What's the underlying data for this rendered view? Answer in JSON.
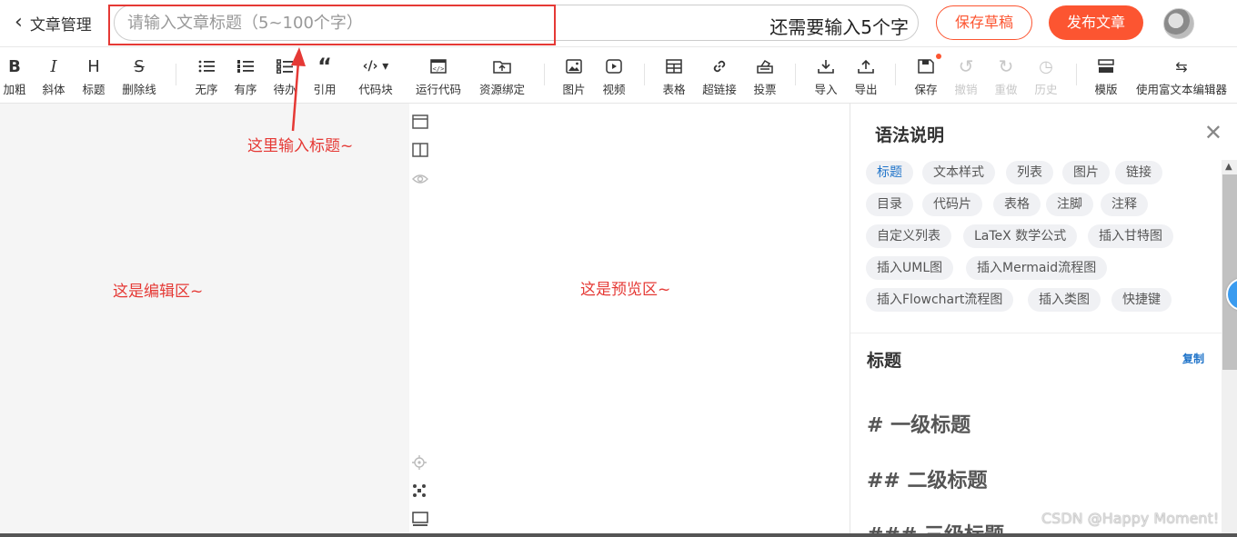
{
  "header": {
    "back_label": "文章管理",
    "title_placeholder": "请输入文章标题（5~100个字）",
    "char_remaining": "还需要输入5个字",
    "save_draft": "保存草稿",
    "publish": "发布文章"
  },
  "toolbar": {
    "bold": "加粗",
    "italic": "斜体",
    "heading": "标题",
    "strike": "删除线",
    "ul": "无序",
    "ol": "有序",
    "todo": "待办",
    "quote": "引用",
    "codeblock": "代码块",
    "run_code": "运行代码",
    "resource": "资源绑定",
    "image": "图片",
    "video": "视频",
    "table": "表格",
    "link": "超链接",
    "vote": "投票",
    "import": "导入",
    "export": "导出",
    "save": "保存",
    "undo": "撤销",
    "redo": "重做",
    "history": "历史",
    "template": "模版",
    "rich_editor": "使用富文本编辑器"
  },
  "annotations": {
    "title_hint": "这里输入标题~",
    "editor_hint": "这是编辑区~",
    "preview_hint": "这是预览区~"
  },
  "help": {
    "title": "语法说明",
    "tags": [
      "标题",
      "文本样式",
      "列表",
      "图片",
      "链接",
      "目录",
      "代码片",
      "表格",
      "注脚",
      "注释",
      "自定义列表",
      "LaTeX 数学公式",
      "插入甘特图",
      "插入UML图",
      "插入Mermaid流程图",
      "插入Flowchart流程图",
      "插入类图",
      "快捷键"
    ],
    "section_title": "标题",
    "copy": "复制",
    "samples": [
      "# 一级标题",
      "## 二级标题",
      "### 三级标题"
    ]
  },
  "watermark": "CSDN @Happy Moment!",
  "colors": {
    "accent": "#fc5531",
    "link": "#1e73c9",
    "annotation": "#e53935"
  }
}
